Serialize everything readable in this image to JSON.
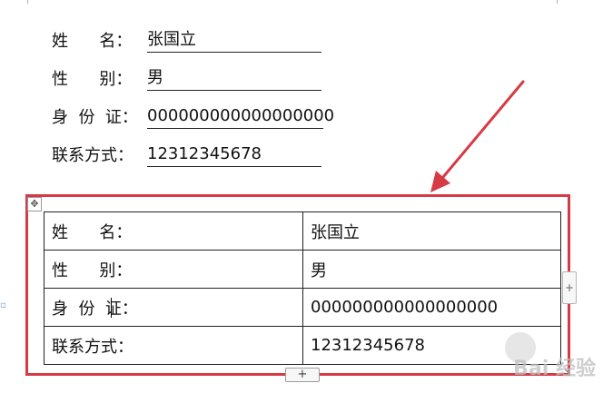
{
  "form": {
    "rows": [
      {
        "label": "姓      名：",
        "value": "张国立"
      },
      {
        "label": "性      别：",
        "value": "男"
      },
      {
        "label": "身  份  证：",
        "value": "000000000000000000"
      },
      {
        "label": "联系方式：",
        "value": "12312345678"
      }
    ]
  },
  "table": {
    "rows": [
      {
        "label": "姓      名：",
        "value": "张国立"
      },
      {
        "label": "性      别：",
        "value": "男"
      },
      {
        "label": "身  份  证：",
        "value": "000000000000000000"
      },
      {
        "label": "联系方式：",
        "value": "12312345678"
      }
    ]
  },
  "controls": {
    "move_handle": "✥",
    "add_row": "+",
    "add_col": "+",
    "resize": "↘",
    "gutter": "▫"
  },
  "watermark": {
    "text": "Bai 经验"
  },
  "colors": {
    "highlight_frame": "#d63a44"
  }
}
